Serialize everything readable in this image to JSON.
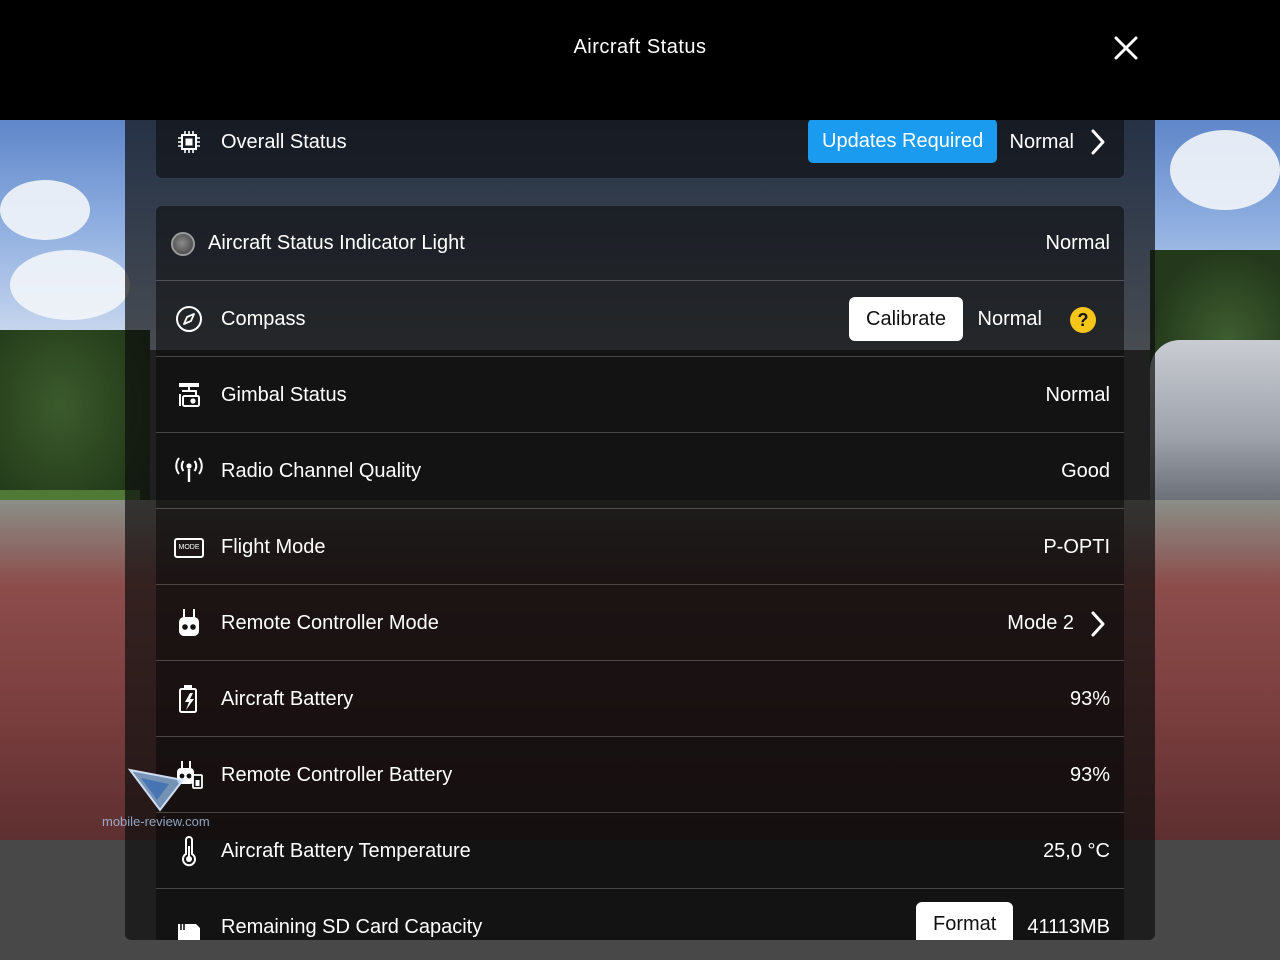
{
  "header": {
    "title": "Aircraft Status"
  },
  "overall": {
    "label": "Overall Status",
    "button": "Updates Required",
    "value": "Normal"
  },
  "rows": {
    "indicator": {
      "label": "Aircraft Status Indicator Light",
      "value": "Normal"
    },
    "compass": {
      "label": "Compass",
      "button": "Calibrate",
      "value": "Normal",
      "help": "?"
    },
    "gimbal": {
      "label": "Gimbal Status",
      "value": "Normal"
    },
    "radio": {
      "label": "Radio Channel Quality",
      "value": "Good"
    },
    "flight_mode": {
      "label": "Flight Mode",
      "value": "P-OPTI",
      "icon_text": "MODE"
    },
    "rc_mode": {
      "label": "Remote Controller Mode",
      "value": "Mode 2"
    },
    "aircraft_battery": {
      "label": "Aircraft Battery",
      "value": "93%"
    },
    "rc_battery": {
      "label": "Remote Controller Battery",
      "value": "93%"
    },
    "battery_temp": {
      "label": "Aircraft Battery Temperature",
      "value": "25,0 °C"
    },
    "sd_card": {
      "label": "Remaining SD Card Capacity",
      "button": "Format",
      "value": "41113MB"
    }
  },
  "watermark": {
    "text": "mobile-review.com"
  },
  "colors": {
    "accent": "#1a9bf0",
    "help": "#f5c518",
    "header": "#000000"
  }
}
